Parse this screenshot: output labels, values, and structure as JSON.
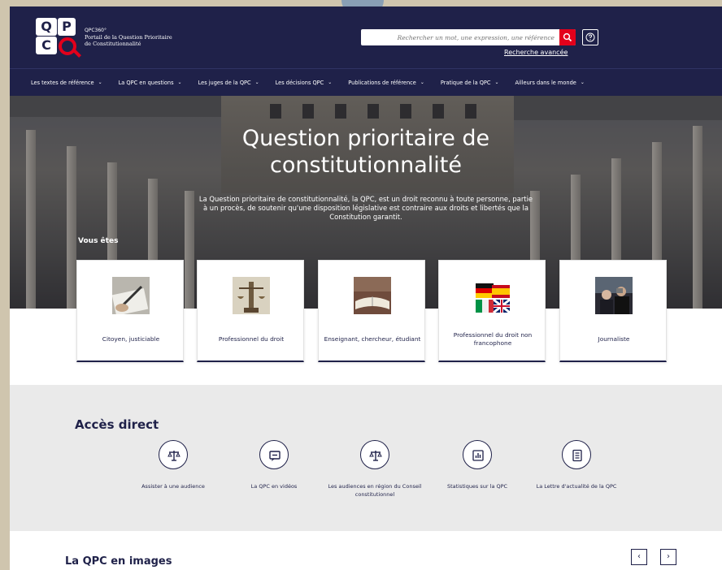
{
  "header": {
    "logo_letters": [
      "Q",
      "P",
      "C"
    ],
    "brand_line1": "QPC360°",
    "brand_line2": "Portail de la Question Prioritaire",
    "brand_line3": "de Constitutionnalité",
    "search_placeholder": "Rechercher un mot, une expression, une référence",
    "advanced_search": "Recherche avancée"
  },
  "nav": {
    "items": [
      {
        "label": "Les textes de référence"
      },
      {
        "label": "La QPC en questions"
      },
      {
        "label": "Les juges de la QPC"
      },
      {
        "label": "Les décisions QPC"
      },
      {
        "label": "Publications de référence"
      },
      {
        "label": "Pratique de la QPC"
      },
      {
        "label": "Ailleurs dans le monde"
      }
    ],
    "chevron": "⌄"
  },
  "hero": {
    "title_line1": "Question prioritaire de",
    "title_line2": "constitutionnalité",
    "description": "La Question prioritaire de constitutionnalité, la QPC, est un droit reconnu à toute personne, partie à un procès, de soutenir qu'une disposition législative est contraire aux droits et libertés que la Constitution garantit.",
    "you_are": "Vous êtes"
  },
  "cards": [
    {
      "label": "Citoyen, justiciable",
      "icon": "pen-signing-image"
    },
    {
      "label": "Professionnel du droit",
      "icon": "justice-statue-image"
    },
    {
      "label": "Enseignant, chercheur, étudiant",
      "icon": "books-image"
    },
    {
      "label": "Professionnel du droit non francophone",
      "icon": "flags-image"
    },
    {
      "label": "Journaliste",
      "icon": "press-image"
    }
  ],
  "acces": {
    "title": "Accès direct",
    "items": [
      {
        "label": "Assister à une audience",
        "icon": "scales-icon"
      },
      {
        "label": "La QPC en vidéos",
        "icon": "video-icon"
      },
      {
        "label": "Les audiences en région du Conseil constitutionnel",
        "icon": "scales-icon"
      },
      {
        "label": "Statistiques sur la QPC",
        "icon": "chart-icon"
      },
      {
        "label": "La Lettre d'actualité de la QPC",
        "icon": "newsletter-icon"
      }
    ]
  },
  "images_section": {
    "title": "La QPC en images",
    "prev": "‹",
    "next": "›"
  },
  "colors": {
    "navy": "#1f2149",
    "red": "#e3001b",
    "gray": "#eaeaea"
  }
}
